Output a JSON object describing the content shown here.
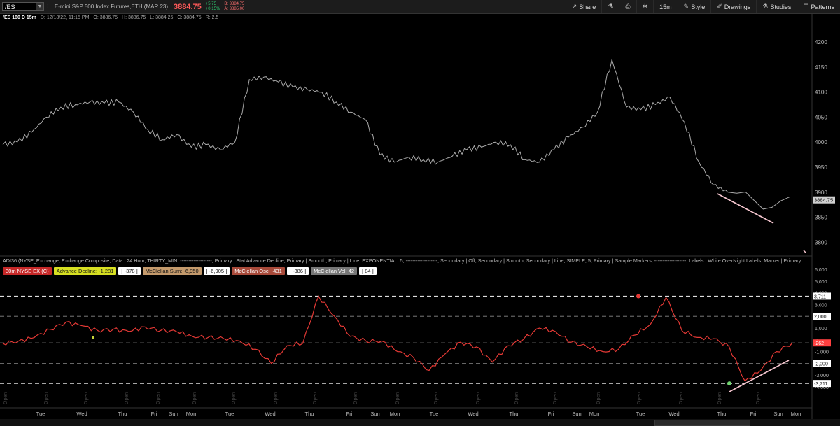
{
  "toolbar": {
    "symbol": "/ES",
    "description": "E-mini S&P 500 Index Futures,ETH (MAR 23)",
    "last_price": "3884.75",
    "net_change": "+5.75",
    "pct_change": "+0.15%",
    "bid": "B: 3884.75",
    "ask": "A: 3885.00",
    "buttons": {
      "share": "Share",
      "timeframe": "15m",
      "style": "Style",
      "drawings": "Drawings",
      "studies": "Studies",
      "patterns": "Patterns"
    }
  },
  "infobar": {
    "title": "/ES 180 D 15m",
    "date": "D: 12/18/22, 11:15 PM",
    "open": "O: 3886.75",
    "high": "H: 3886.75",
    "low": "L: 3884.25",
    "close": "C: 3884.75",
    "range": "R: 2.5"
  },
  "price_axis": {
    "ticks": [
      "4200",
      "4150",
      "4100",
      "4050",
      "4000",
      "3950",
      "3900",
      "3850",
      "3800"
    ],
    "last_label": "3884.75"
  },
  "study": {
    "label": "ADI36 (NYSE_Exchange, Exchange Composite, Data | 24 Hour, THIRTY_MIN, -------------------, Primary | Stat Advance Decline, Primary | Smooth, Primary | Line, EXPONENTIAL, 5, -------------------, Secondary | Off, Secondary | Smooth, Secondary | Line, SIMPLE, 5, Primary | Sample Markers, -------------------, Labels | White OverNight Labels, Marker | Primary ...",
    "badges": [
      "30m   NYSE EX (C)",
      "Advance Decline: -1,281",
      "[ -378 ]",
      "McClellan Sum: -6,950",
      "[ -6,905 ]",
      "McClellan Osc: -431",
      "[ -386 ]",
      "McClellan Vel: 42",
      "[ 84 ]"
    ],
    "axis_ticks": [
      "6,000",
      "5,000",
      "4,000",
      "3,000",
      "2,000",
      "1,000",
      "0",
      "-1,000",
      "-2,000",
      "-3,000",
      "-4,000"
    ],
    "axis_labels": [
      "3,711",
      "2,000",
      "-262",
      "-2,000",
      "-3,711"
    ],
    "open_labels": [
      "Open",
      "Open",
      "Open",
      "Open",
      "Open",
      "Open",
      "Open",
      "Open",
      "Open",
      "Open",
      "Open",
      "Open",
      "Open",
      "Open",
      "Open",
      "Open",
      "Open",
      "Open",
      "Open",
      "Open"
    ]
  },
  "time_axis": [
    "Tue",
    "Wed",
    "Thu",
    "Fri",
    "Sun",
    "Mon",
    "Tue",
    "Wed",
    "Thu",
    "Fri",
    "Sun",
    "Mon",
    "Tue",
    "Wed",
    "Thu",
    "Fri",
    "Sun",
    "Mon",
    "Tue",
    "Wed",
    "Thu",
    "Fri",
    "Sun",
    "Mon"
  ],
  "chart_data": [
    {
      "type": "line",
      "title": "/ES 180 D 15m",
      "ylim": [
        3770,
        4220
      ],
      "x": [
        0,
        1,
        2,
        3,
        4,
        5,
        6,
        7,
        8,
        9,
        10,
        11,
        12,
        13,
        14,
        15,
        16,
        17,
        18,
        19,
        20,
        21,
        22,
        23,
        24,
        25,
        26,
        27,
        28,
        29,
        30,
        31,
        32,
        33,
        34,
        35,
        36,
        37,
        38,
        39,
        40,
        41,
        42,
        43,
        44,
        45,
        46,
        47,
        48,
        49,
        50
      ],
      "series": [
        {
          "values": [
            3995,
            4000,
            4020,
            4050,
            4070,
            4075,
            4080,
            4078,
            4080,
            4060,
            4025,
            4005,
            4015,
            3990,
            3995,
            3985,
            4000,
            4125,
            4130,
            4120,
            4110,
            4105,
            4100,
            4080,
            4060,
            4045,
            3975,
            3960,
            3970,
            3965,
            3960,
            3972,
            3985,
            3990,
            4000,
            3995,
            3965,
            3960,
            3985,
            4010,
            4030,
            4060,
            4165,
            4070,
            4065,
            4075,
            4090,
            4040,
            3960,
            3915,
            3900
          ]
        },
        {
          "values": [
            3898,
            3895,
            3880,
            3870,
            3875,
            3882,
            3885
          ]
        }
      ]
    },
    {
      "type": "line",
      "series": [
        {
          "name": "Advance Decline",
          "values": [
            -300,
            -100,
            200,
            900,
            1500,
            1200,
            800,
            900,
            700,
            1100,
            800,
            700,
            300,
            200,
            100,
            -100,
            -800,
            -2000,
            -500,
            -300,
            3700,
            2000,
            300,
            -100,
            -100,
            -1000,
            -1500,
            -2600,
            -1200,
            -200,
            -600,
            -1900,
            -500,
            100,
            1000,
            700,
            -200,
            -600,
            -1000,
            -800,
            400,
            1300,
            3600,
            800,
            200,
            100,
            -600,
            -3500,
            -2600,
            -1000,
            -262
          ]
        }
      ],
      "axis_values": [
        3711,
        2000,
        -262,
        -2000,
        -3711
      ]
    }
  ]
}
